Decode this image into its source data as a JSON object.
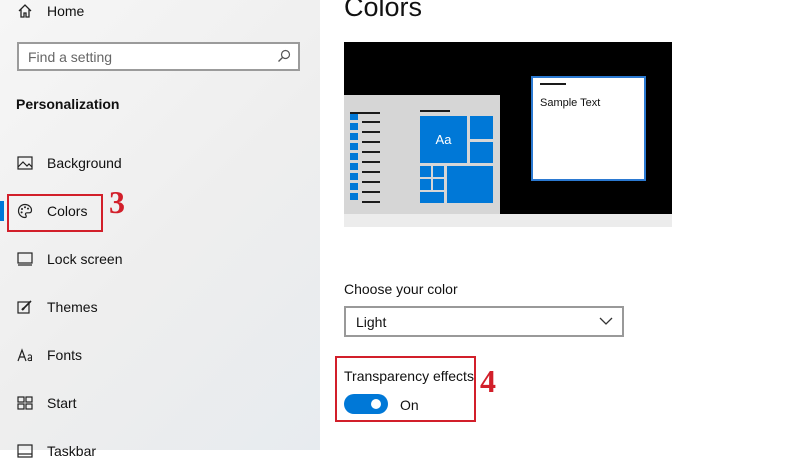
{
  "sidebar": {
    "home_label": "Home",
    "search_placeholder": "Find a setting",
    "section_title": "Personalization",
    "items": [
      {
        "label": "Background",
        "icon": "background-image-icon"
      },
      {
        "label": "Colors",
        "icon": "palette-icon",
        "selected": true
      },
      {
        "label": "Lock screen",
        "icon": "lock-screen-icon"
      },
      {
        "label": "Themes",
        "icon": "themes-brush-icon"
      },
      {
        "label": "Fonts",
        "icon": "fonts-icon"
      },
      {
        "label": "Start",
        "icon": "start-icon"
      },
      {
        "label": "Taskbar",
        "icon": "taskbar-icon"
      }
    ]
  },
  "main": {
    "title": "Colors",
    "preview": {
      "tile_text": "Aa",
      "sample_text": "Sample Text"
    },
    "choose_color": {
      "label": "Choose your color",
      "value": "Light"
    },
    "transparency": {
      "label": "Transparency effects",
      "state": "On"
    }
  },
  "annotations": {
    "step_colors": "3",
    "step_transparency": "4"
  },
  "colors": {
    "accent": "#0078d7",
    "callout": "#d21f2a"
  }
}
